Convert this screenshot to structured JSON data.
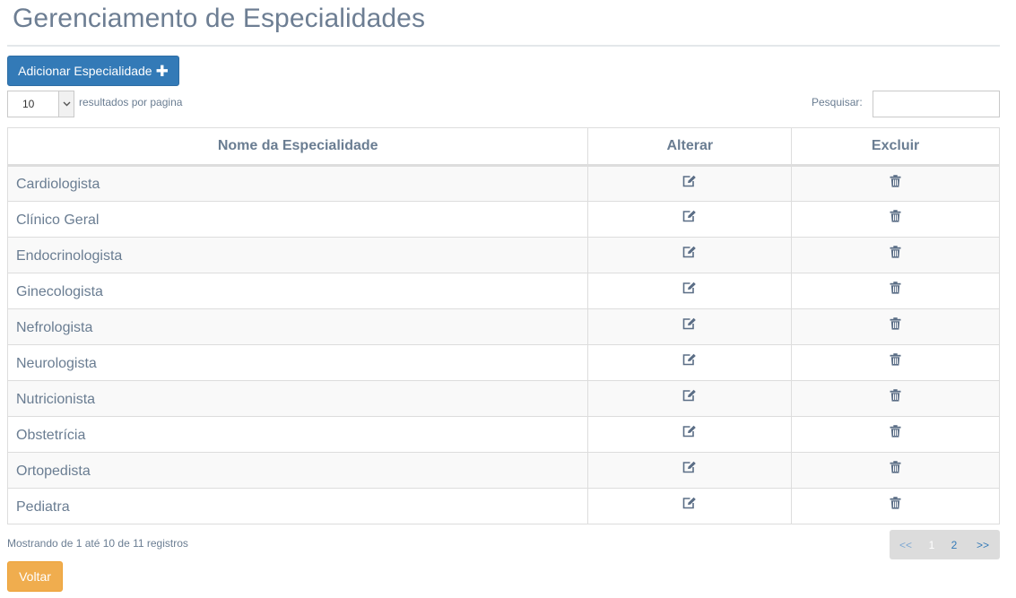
{
  "page": {
    "title": "Gerenciamento de Especialidades"
  },
  "toolbar": {
    "add_label": "Adicionar Especialidade",
    "add_icon": "plus-icon"
  },
  "length": {
    "value": "10",
    "label": "resultados por pagina"
  },
  "search": {
    "label": "Pesquisar:",
    "value": "",
    "placeholder": ""
  },
  "table": {
    "headers": {
      "name": "Nome da Especialidade",
      "edit": "Alterar",
      "delete": "Excluir"
    },
    "edit_icon": "edit-icon",
    "delete_icon": "trash-icon",
    "rows": [
      {
        "name": "Cardiologista"
      },
      {
        "name": "Clínico Geral"
      },
      {
        "name": "Endocrinologista"
      },
      {
        "name": "Ginecologista"
      },
      {
        "name": "Nefrologista"
      },
      {
        "name": "Neurologista"
      },
      {
        "name": "Nutricionista"
      },
      {
        "name": "Obstetrícia"
      },
      {
        "name": "Ortopedista"
      },
      {
        "name": "Pediatra"
      }
    ]
  },
  "footer": {
    "info": "Mostrando de 1 até 10 de 11 registros",
    "back_label": "Voltar"
  },
  "pagination": {
    "prev": "<<",
    "pages": [
      "1",
      "2"
    ],
    "current": "1",
    "next": ">>"
  },
  "colors": {
    "primary": "#337ab7",
    "warning": "#f0ad4e",
    "text": "#6a7d92"
  }
}
